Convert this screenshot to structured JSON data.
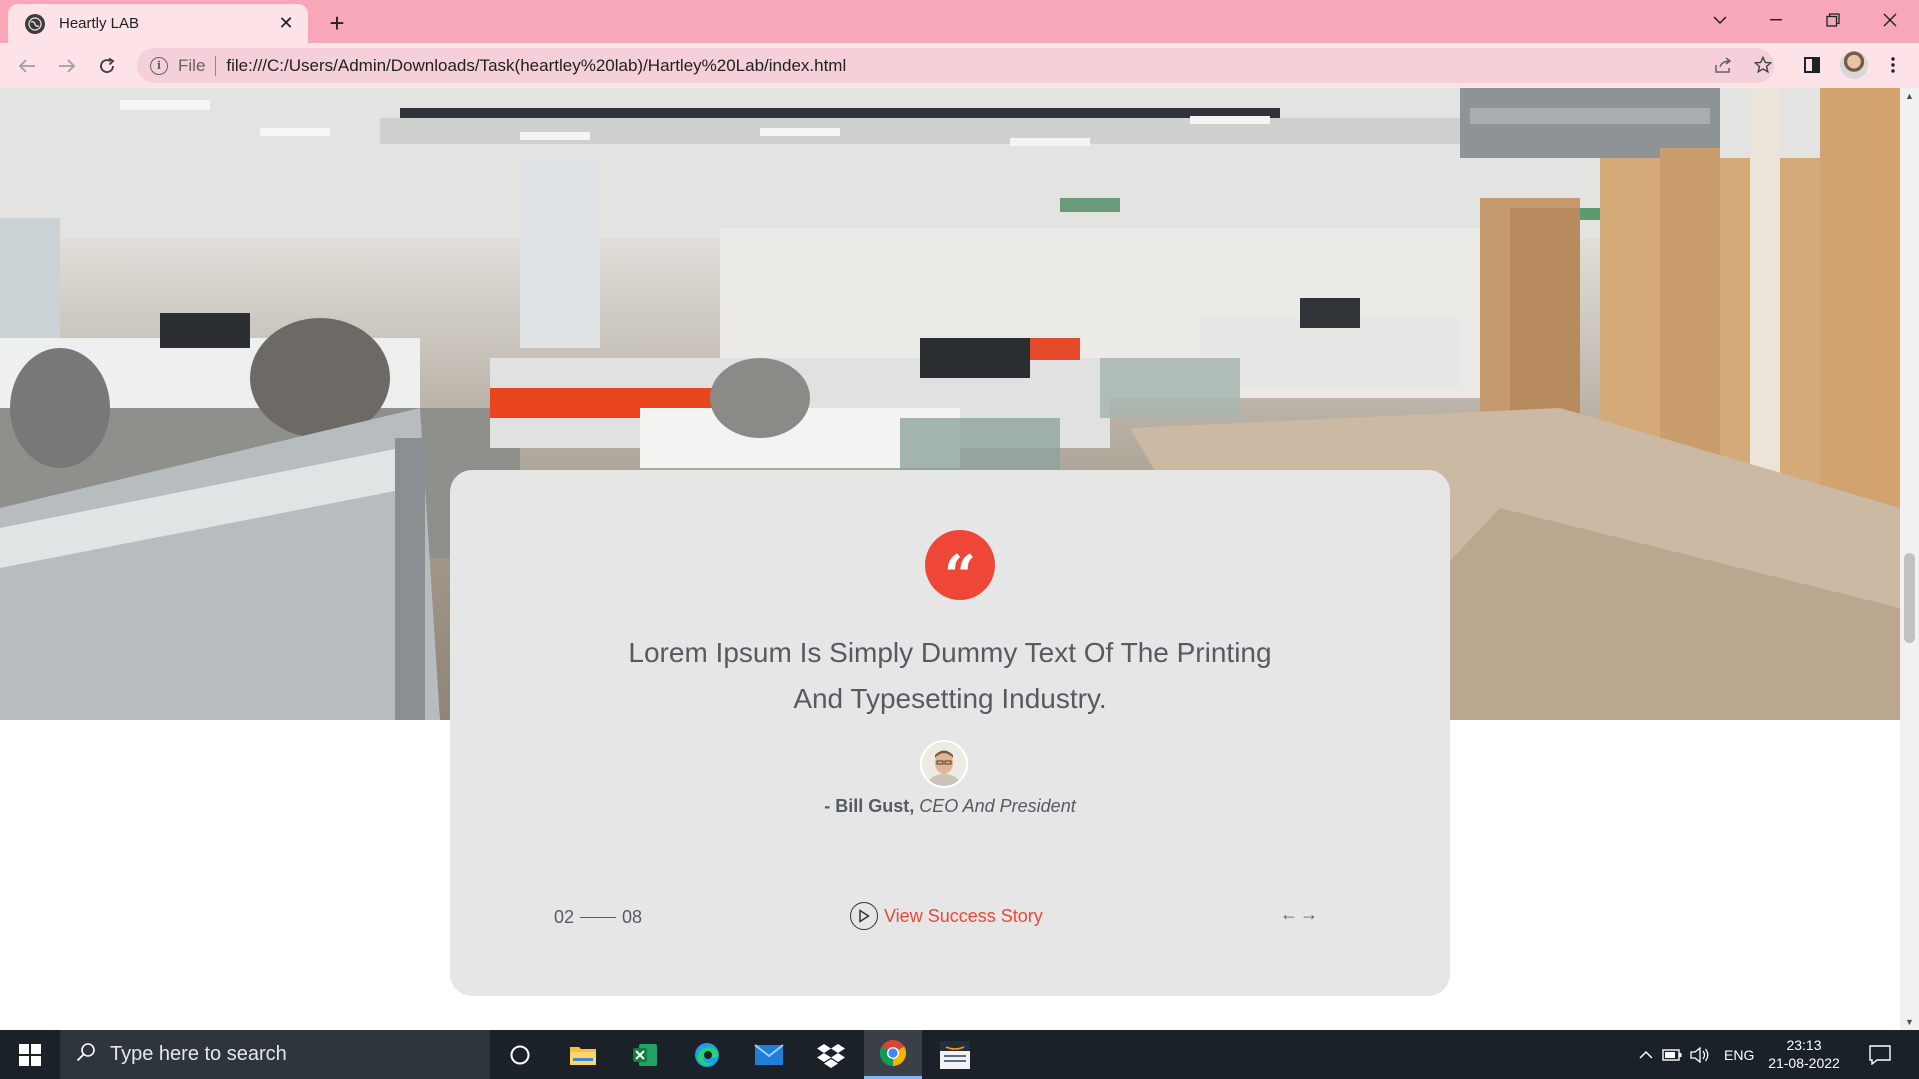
{
  "browser": {
    "tab_title": "Heartly LAB",
    "address_scheme": "File",
    "address_url": "file:///C:/Users/Admin/Downloads/Task(heartley%20lab)/Hartley%20Lab/index.html"
  },
  "testimonial": {
    "quote_mark": "“",
    "quote_line1": "Lorem Ipsum Is Simply Dummy Text Of The Printing",
    "quote_line2": "And Typesetting Industry.",
    "author_name": "- Bill Gust,",
    "author_role": "CEO And President",
    "counter_current": "02",
    "counter_total": "08",
    "story_label": "View Success Story",
    "prev_arrow": "←",
    "next_arrow": "→",
    "accent_color": "#ee4637"
  },
  "taskbar": {
    "search_placeholder": "Type here to search",
    "language": "ENG",
    "time": "23:13",
    "date": "21-08-2022",
    "apps": [
      "cortana-icon",
      "file-explorer-icon",
      "excel-icon",
      "edge-icon",
      "mail-icon",
      "dropbox-icon",
      "chrome-icon",
      "amazon-icon"
    ]
  }
}
